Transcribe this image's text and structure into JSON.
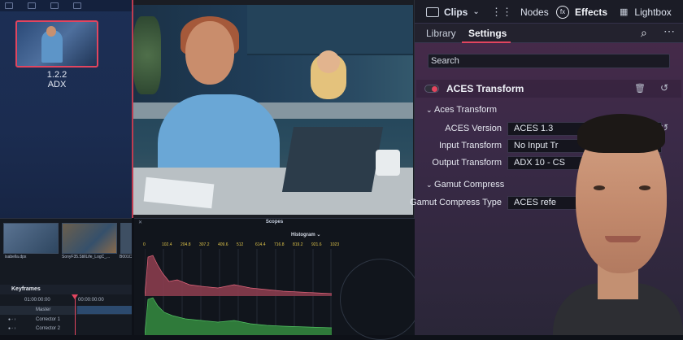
{
  "gallery": {
    "still": {
      "version": "1.2.2",
      "label": "ADX"
    }
  },
  "timeline": {
    "clips": [
      {
        "label": "isabella.dpx"
      },
      {
        "label": "SonyF35.StillLife_LogC_..."
      },
      {
        "label": "B001C"
      }
    ],
    "keyframes": {
      "title": "Keyframes",
      "timecode_start": "01:00:00:00",
      "timecode_end": "00:00:00:00",
      "rows": [
        {
          "label": "Master"
        },
        {
          "label": "Corrector 1"
        },
        {
          "label": "Corrector 2"
        }
      ]
    }
  },
  "scopes": {
    "title": "Scopes",
    "mode": "Histogram",
    "ticks": [
      "0",
      "102.4",
      "204.8",
      "307.2",
      "409.6",
      "512",
      "614.4",
      "716.8",
      "819.2",
      "921.6",
      "1023"
    ]
  },
  "toolbar": {
    "clips": "Clips",
    "nodes": "Nodes",
    "effects": "Effects",
    "lightbox": "Lightbox",
    "fx_glyph": "fx"
  },
  "tabs": {
    "library": "Library",
    "settings": "Settings"
  },
  "search": {
    "placeholder": "Search"
  },
  "effect": {
    "title": "ACES Transform",
    "enabled": true,
    "sections": {
      "aces": "Aces Transform",
      "gamut": "Gamut Compress"
    },
    "fields": {
      "aces_version": {
        "label": "ACES Version",
        "value": "ACES 1.3"
      },
      "input_transform": {
        "label": "Input Transform",
        "value": "No Input Tr"
      },
      "output_transform": {
        "label": "Output Transform",
        "value": "ADX 10 - CS"
      },
      "gamut_type": {
        "label": "Gamut Compress Type",
        "value": "ACES refe"
      }
    }
  },
  "colors": {
    "accent": "#e2455f",
    "panel": "#3b2a48"
  }
}
